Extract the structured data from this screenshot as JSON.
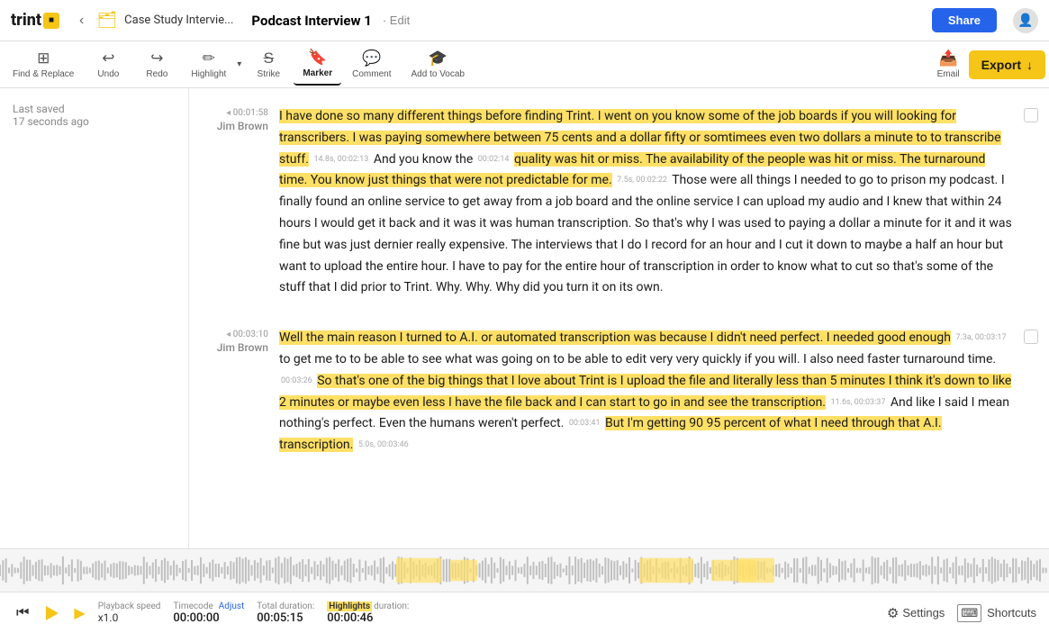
{
  "header": {
    "logo_text": "trint",
    "back_label": "‹",
    "folder_label": "📁",
    "breadcrumb": "Case Study Intervie...",
    "doc_title": "Podcast Interview 1",
    "edit_label": "· Edit",
    "share_label": "Share",
    "user_icon": "👤"
  },
  "toolbar": {
    "find_replace": "Find & Replace",
    "undo": "Undo",
    "redo": "Redo",
    "highlight": "Highlight",
    "strike": "Strike",
    "marker": "Marker",
    "comment": "Comment",
    "add_vocab": "Add to Vocab",
    "email": "Email",
    "export": "Export"
  },
  "sidebar": {
    "saved_label": "Last saved",
    "saved_time": "17 seconds ago"
  },
  "segments": [
    {
      "speaker": "Jim Brown",
      "timecode": "00:01:58",
      "text_parts": [
        {
          "text": "I have done so many different things before finding Trint. I went on you know some of the job boards if you will looking for transcribers. I was paying somewhere between 75 cents and a dollar fifty or somtimees even two dollars a minute to to transcribe stuff.",
          "highlight": true
        },
        {
          "text": " And you know the ",
          "highlight": false
        },
        {
          "text": "quality was hit or miss. The availability of the people was hit or miss. The turnaround time. You know just things that were not predictable for me.",
          "highlight": true
        },
        {
          "text": " Those were all things I needed to go to prison my podcast. I finally found an online service to get away from a job board and the online service I can upload my audio and I knew that within 24 hours I would get it back and it was it was human transcription. So that's why I was used to paying a dollar a minute for it and it was fine but was just dernier really expensive. The interviews that I do I record for an hour and I cut it down to maybe a half an hour but want to upload the entire hour. I have to pay for the entire hour of transcription in order to know what to cut so that's some of the stuff that I did prior to Trint. Why. Why. Why did you turn it on its own.",
          "highlight": false
        }
      ],
      "inline_codes": [
        "14.8s, 00:02:13",
        "00:02:14",
        "7.5s, 00:02:22"
      ]
    },
    {
      "speaker": "Jim Brown",
      "timecode": "00:03:10",
      "text_parts": [
        {
          "text": "Well the main reason I turned to A.I. or automated transcription was because I didn't need perfect. I needed good enough",
          "highlight": true
        },
        {
          "text": " to get me to to be able to see what was going on to be able to edit very very quickly if you will. I also need faster turnaround time. ",
          "highlight": false
        },
        {
          "text": "So that's one of the big things that I love about Trint is I upload the file and literally less than 5 minutes I think it's down to like 2 minutes or maybe even less I have the file back and I can start to go in and see the transcription.",
          "highlight": true
        },
        {
          "text": " And like I said I mean nothing's perfect. Even the humans weren't perfect. ",
          "highlight": false
        },
        {
          "text": "But I'm getting 90 95 percent of what I need through that A.I. transcription.",
          "highlight": true
        }
      ],
      "inline_codes": [
        "7.3a, 00:03:17",
        "00:03:26",
        "11.6s, 00:03:37",
        "00:03:41",
        "5.0s, 00:03:46"
      ]
    }
  ],
  "bottom": {
    "playback_label": "Playback speed",
    "playback_val": "x1.0",
    "timecode_label": "Timecode",
    "adjust_label": "Adjust",
    "timecode_val": "00:00:00",
    "duration_label": "Total duration:",
    "duration_val": "00:05:15",
    "highlights_label": "duration:",
    "highlights_keyword": "Highlights",
    "highlights_val": "00:00:46",
    "settings_label": "Settings",
    "shortcuts_label": "Shortcuts"
  }
}
